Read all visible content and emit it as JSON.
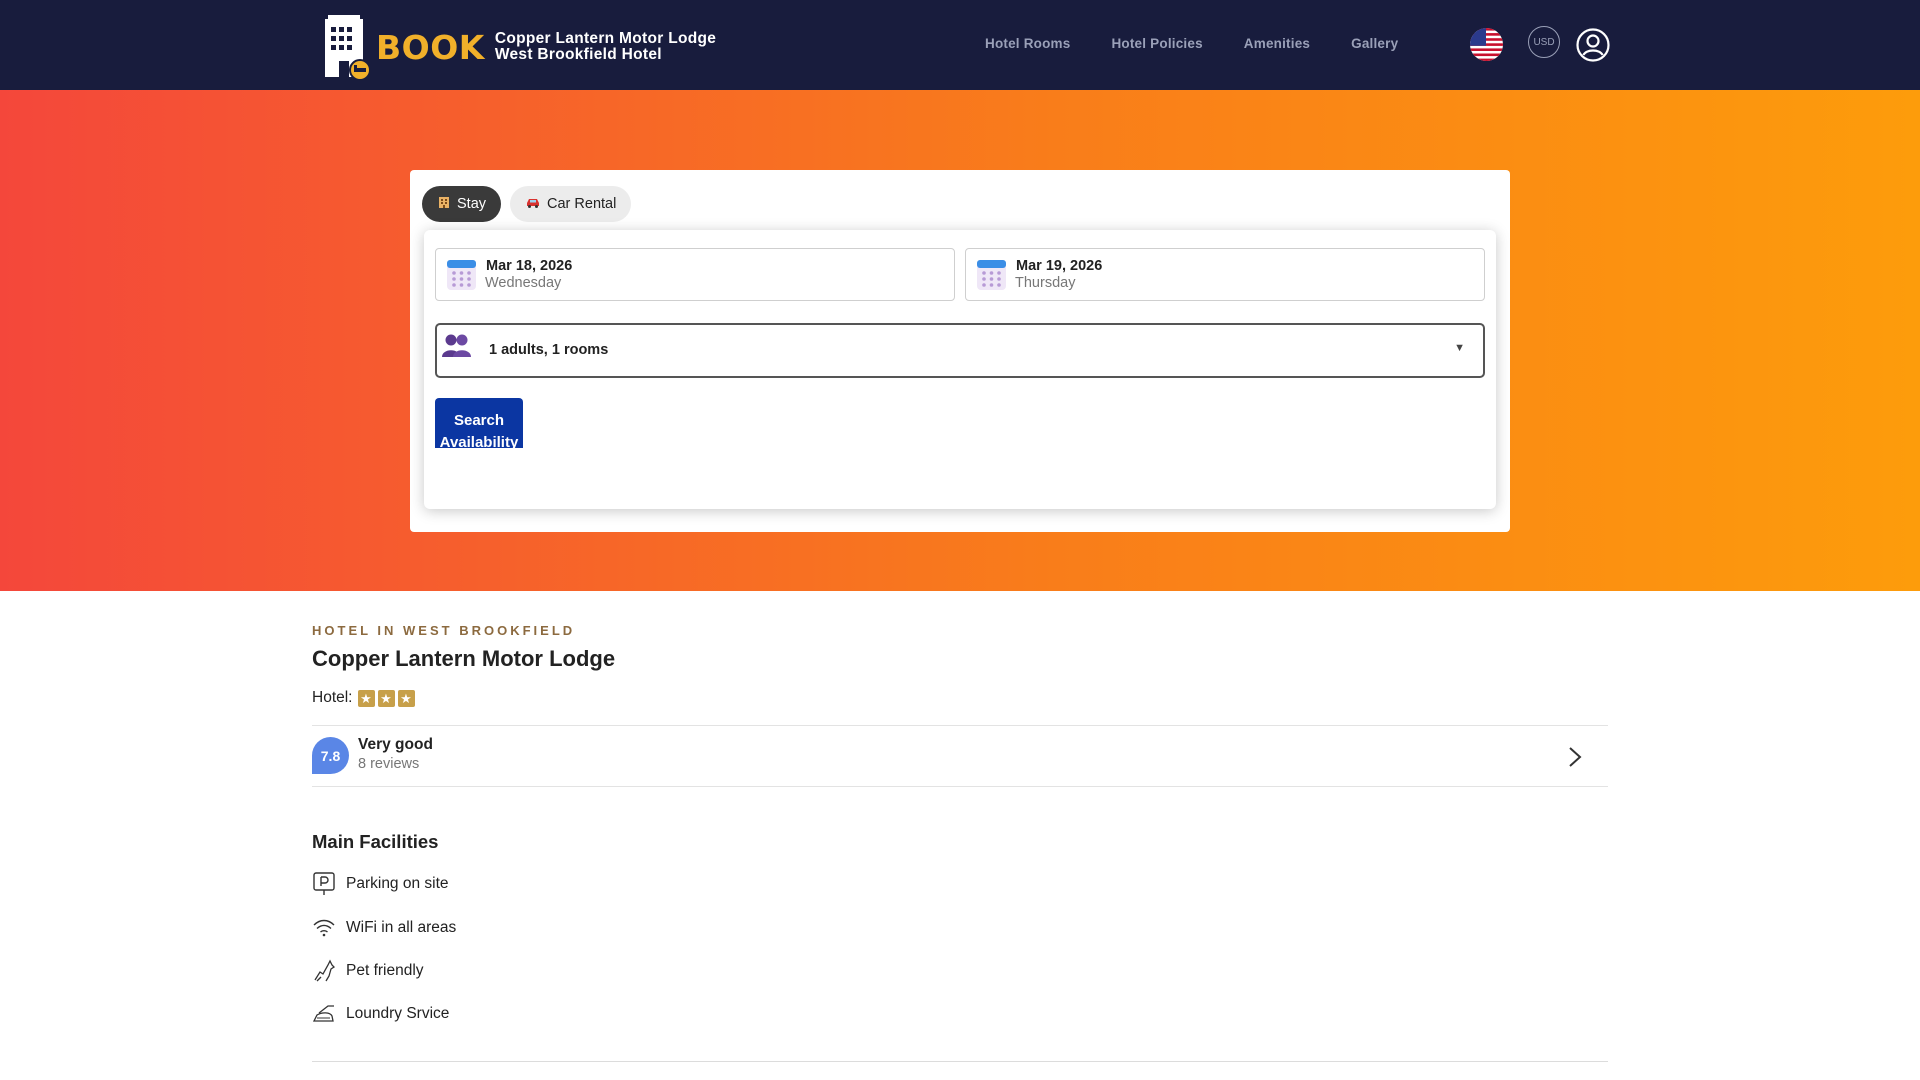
{
  "header": {
    "brand_word": "BOOK",
    "hotel_name": "Copper Lantern Motor Lodge",
    "hotel_subtitle": "West Brookfield Hotel",
    "nav": [
      {
        "label": "Hotel Rooms"
      },
      {
        "label": "Hotel Policies"
      },
      {
        "label": "Amenities"
      },
      {
        "label": "Gallery"
      }
    ],
    "currency": "USD",
    "icons": {
      "flag": "us-flag-icon",
      "user": "user-account-icon",
      "logo": "hotel-building-icon"
    }
  },
  "search": {
    "tabs": [
      {
        "label": "Stay",
        "icon": "hotel-icon",
        "active": true
      },
      {
        "label": "Car Rental",
        "icon": "car-icon",
        "active": false
      }
    ],
    "checkin": {
      "date": "Mar 18, 2026",
      "weekday": "Wednesday"
    },
    "checkout": {
      "date": "Mar 19, 2026",
      "weekday": "Thursday"
    },
    "guests": "1 adults, 1 rooms",
    "button_line1": "Search",
    "button_line2": "Availability"
  },
  "hotel": {
    "eyebrow": "HOTEL IN WEST BROOKFIELD",
    "name": "Copper Lantern Motor Lodge",
    "stars_label": "Hotel:",
    "stars": 3,
    "score": "7.8",
    "rating_label": "Very good",
    "reviews": "8 reviews"
  },
  "facilities": {
    "title": "Main Facilities",
    "items": [
      {
        "label": "Parking on site",
        "icon": "parking-icon"
      },
      {
        "label": "WiFi in all areas",
        "icon": "wifi-icon"
      },
      {
        "label": "Pet friendly",
        "icon": "pet-icon"
      },
      {
        "label": "Loundry Srvice",
        "icon": "laundry-iron-icon"
      }
    ]
  },
  "colors": {
    "header_bg": "#181c3d",
    "brand_gold": "#f1b02a",
    "hero_start": "#f4473b",
    "hero_end": "#fd9c0b",
    "button_blue": "#0b36a2",
    "score_blue": "#5a86e6",
    "star_gold": "#c7a04a"
  }
}
